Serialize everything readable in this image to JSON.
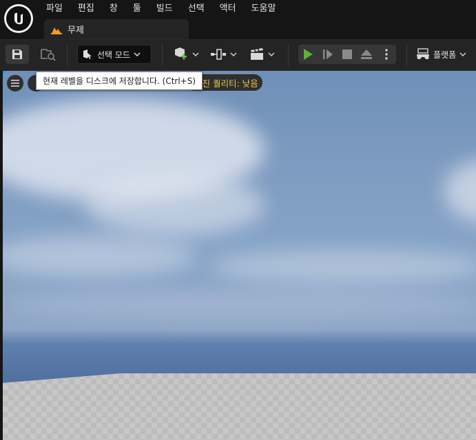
{
  "menu": [
    "파일",
    "편집",
    "창",
    "툴",
    "빌드",
    "선택",
    "액터",
    "도움말"
  ],
  "document_tab": {
    "label": "무제"
  },
  "toolbar": {
    "mode_label": "선택 모드",
    "platform_label": "플랫폼",
    "play_color": "#5cb23a"
  },
  "viewport": {
    "quality_text": "리진 퀄리티: 낮음"
  },
  "tooltip": {
    "text": "현재 레벨을 디스크에 저장합니다. (Ctrl+S)"
  },
  "colors": {
    "accent": "#e8c84a",
    "menu_bg": "#151515",
    "toolbar_bg": "#242424"
  }
}
